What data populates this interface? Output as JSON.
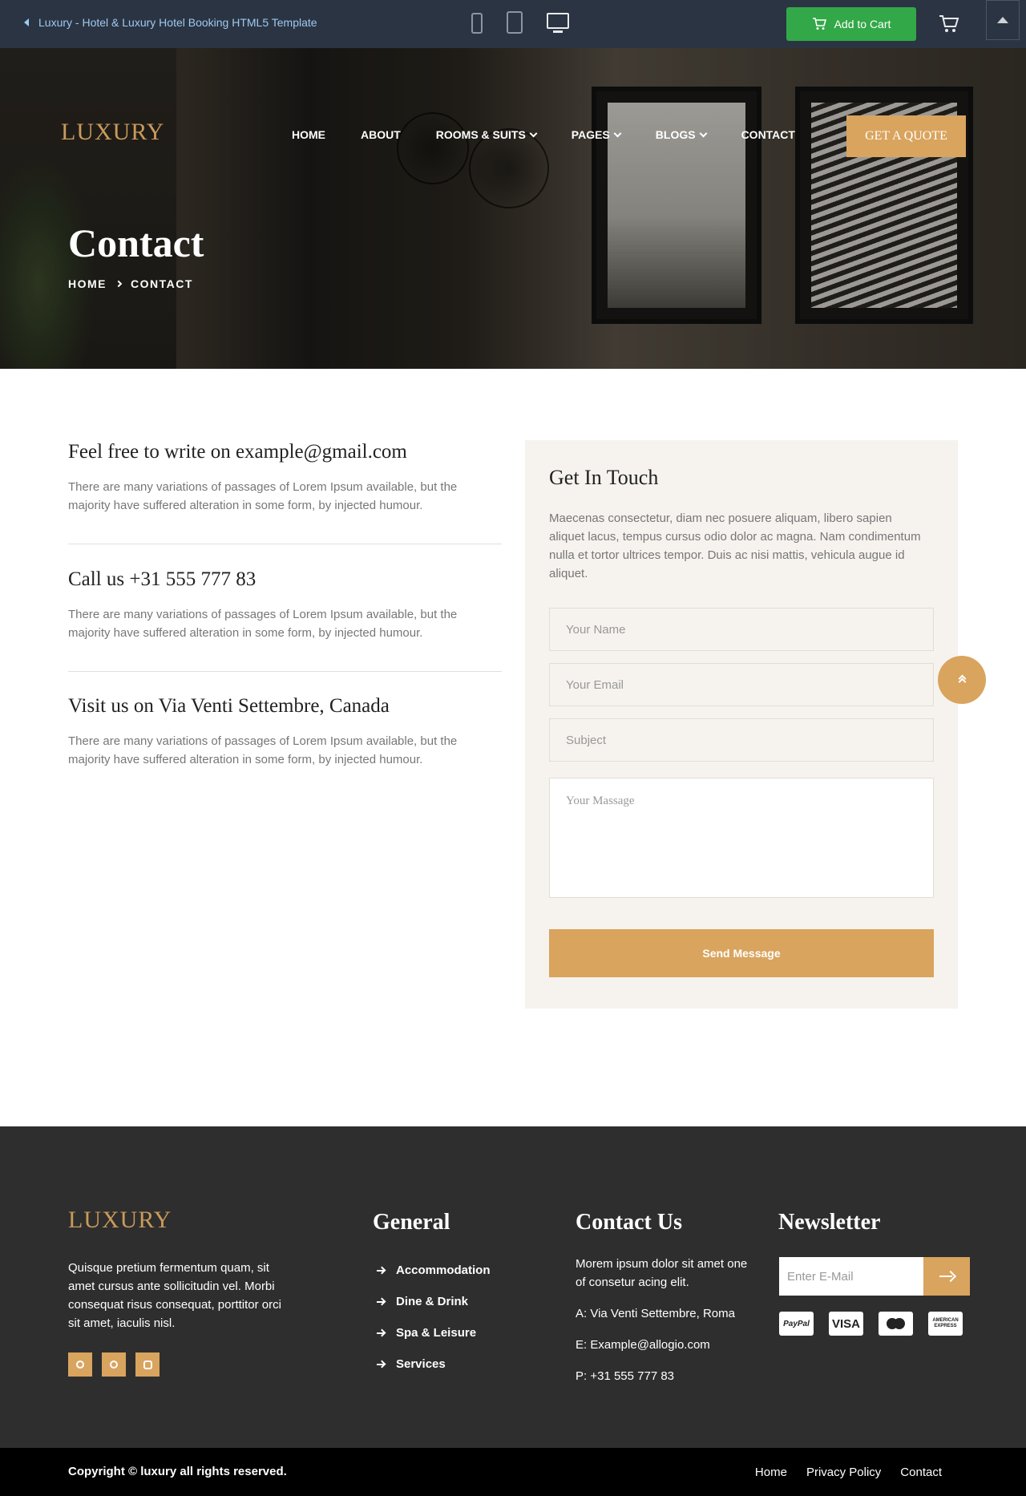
{
  "preview_bar": {
    "title": "Luxury - Hotel & Luxury Hotel Booking HTML5 Template",
    "add_to_cart": "Add to Cart"
  },
  "header": {
    "logo": "LUXURY",
    "nav": [
      "HOME",
      "ABOUT",
      "ROOMS & SUITS",
      "PAGES",
      "BLOGS",
      "CONTACT"
    ],
    "quote_button": "GET A QUOTE"
  },
  "hero": {
    "title": "Contact",
    "breadcrumb": [
      "HOME",
      "CONTACT"
    ]
  },
  "contact_info": [
    {
      "heading": "Feel free to write on example@gmail.com",
      "text": "There are many variations of passages of Lorem Ipsum available, but the majority have suffered alteration in some form, by injected humour."
    },
    {
      "heading": "Call us +31 555 777 83",
      "text": "There are many variations of passages of Lorem Ipsum available, but the majority have suffered alteration in some form, by injected humour."
    },
    {
      "heading": "Visit us on Via Venti Settembre, Canada",
      "text": "There are many variations of passages of Lorem Ipsum available, but the majority have suffered alteration in some form, by injected humour."
    }
  ],
  "form": {
    "title": "Get In Touch",
    "description": "Maecenas consectetur, diam nec posuere aliquam, libero sapien aliquet lacus, tempus cursus odio dolor ac magna. Nam condimentum nulla et tortor ultrices tempor. Duis ac nisi mattis, vehicula augue id aliquet.",
    "name_placeholder": "Your Name",
    "email_placeholder": "Your Email",
    "subject_placeholder": "Subject",
    "message_placeholder": "Your Massage",
    "submit": "Send Message"
  },
  "footer": {
    "logo": "LUXURY",
    "about": "Quisque pretium fermentum quam, sit amet cursus ante sollicitudin vel. Morbi consequat risus consequat, porttitor orci sit amet, iaculis nisl.",
    "general_heading": "General",
    "general_links": [
      "Accommodation",
      "Dine & Drink",
      "Spa & Leisure",
      "Services"
    ],
    "contact_heading": "Contact Us",
    "contact_intro": "Morem ipsum dolor sit amet one of consetur acing elit.",
    "contact_address": "A: Via Venti Settembre, Roma",
    "contact_email": "E: Example@allogio.com",
    "contact_phone": "P: +31 555 777 83",
    "newsletter_heading": "Newsletter",
    "newsletter_placeholder": "Enter E-Mail",
    "payments": [
      "PayPal",
      "VISA",
      "mastercard",
      "AMERICAN EXPRESS"
    ]
  },
  "bottom_bar": {
    "copyright": "Copyright © luxury all rights reserved.",
    "links": [
      "Home",
      "Privacy Policy",
      "Contact"
    ]
  },
  "colors": {
    "accent": "#d9a45e",
    "footer_bg": "#2e2e2e",
    "preview_bar_bg": "#2b3442",
    "cart_green": "#33a848"
  }
}
